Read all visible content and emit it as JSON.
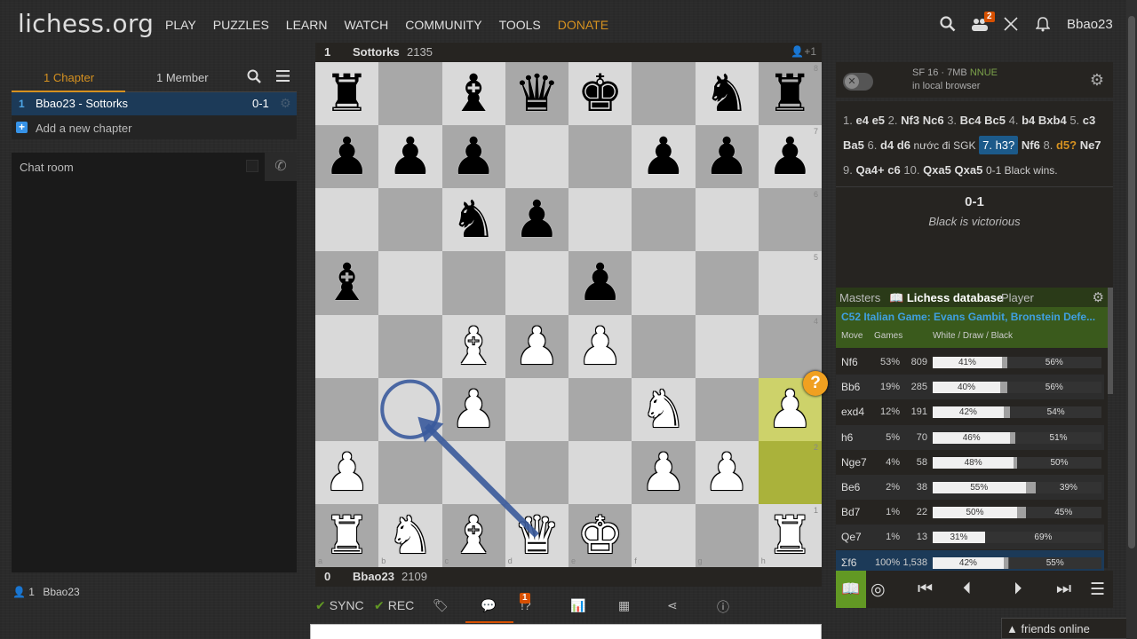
{
  "header": {
    "logo": "lichess.org",
    "nav": [
      "PLAY",
      "PUZZLES",
      "LEARN",
      "WATCH",
      "COMMUNITY",
      "TOOLS",
      "DONATE"
    ],
    "challenge_count": "2",
    "username": "Bbao23"
  },
  "study": {
    "tabs": [
      "1 Chapter",
      "1 Member"
    ],
    "chapter": {
      "num": "1",
      "name": "Bbao23 - Sottorks",
      "result": "0-1"
    },
    "add_chapter": "Add a new chapter",
    "chat_title": "Chat room",
    "members": "1",
    "member_name": "Bbao23"
  },
  "players": {
    "top": {
      "score": "1",
      "name": "Sottorks",
      "rating": "2135",
      "extra": "+1"
    },
    "bottom": {
      "score": "0",
      "name": "Bbao23",
      "rating": "2109"
    }
  },
  "board": {
    "files": [
      "a",
      "b",
      "c",
      "d",
      "e",
      "f",
      "g",
      "h"
    ],
    "ranks": [
      "8",
      "7",
      "6",
      "5",
      "4",
      "3",
      "2",
      "1"
    ],
    "pieces": [
      {
        "sq": "a8",
        "p": "r"
      },
      {
        "sq": "c8",
        "p": "b"
      },
      {
        "sq": "d8",
        "p": "q"
      },
      {
        "sq": "e8",
        "p": "k"
      },
      {
        "sq": "g8",
        "p": "n"
      },
      {
        "sq": "h8",
        "p": "r"
      },
      {
        "sq": "a7",
        "p": "p"
      },
      {
        "sq": "b7",
        "p": "p"
      },
      {
        "sq": "c7",
        "p": "p"
      },
      {
        "sq": "f7",
        "p": "p"
      },
      {
        "sq": "g7",
        "p": "p"
      },
      {
        "sq": "h7",
        "p": "p"
      },
      {
        "sq": "c6",
        "p": "n"
      },
      {
        "sq": "d6",
        "p": "p"
      },
      {
        "sq": "a5",
        "p": "b"
      },
      {
        "sq": "e5",
        "p": "p"
      },
      {
        "sq": "c4",
        "p": "B"
      },
      {
        "sq": "d4",
        "p": "P"
      },
      {
        "sq": "e4",
        "p": "P"
      },
      {
        "sq": "c3",
        "p": "P"
      },
      {
        "sq": "f3",
        "p": "N"
      },
      {
        "sq": "h3",
        "p": "P"
      },
      {
        "sq": "a2",
        "p": "P"
      },
      {
        "sq": "f2",
        "p": "P"
      },
      {
        "sq": "g2",
        "p": "P"
      },
      {
        "sq": "a1",
        "p": "R"
      },
      {
        "sq": "b1",
        "p": "N"
      },
      {
        "sq": "c1",
        "p": "B"
      },
      {
        "sq": "d1",
        "p": "Q"
      },
      {
        "sq": "e1",
        "p": "K"
      },
      {
        "sq": "h1",
        "p": "R"
      }
    ],
    "last_move": [
      "h2",
      "h3"
    ],
    "arrow": {
      "from": "d1",
      "to": "b3",
      "color": "#3a5a9c"
    }
  },
  "tools": {
    "sync": "SYNC",
    "rec": "REC",
    "notif": "1"
  },
  "engine": {
    "name": "SF 16 · 7MB",
    "nnue": "NNUE",
    "location": "in local browser"
  },
  "moves": {
    "seq": [
      {
        "t": "idx",
        "v": "1."
      },
      {
        "t": "mv",
        "v": "e4"
      },
      {
        "t": "mv",
        "v": "e5"
      },
      {
        "t": "idx",
        "v": "2."
      },
      {
        "t": "mv",
        "v": "Nf3"
      },
      {
        "t": "mv",
        "v": "Nc6"
      },
      {
        "t": "idx",
        "v": "3."
      },
      {
        "t": "mv",
        "v": "Bc4"
      },
      {
        "t": "mv",
        "v": "Bc5"
      },
      {
        "t": "idx",
        "v": "4."
      },
      {
        "t": "mv",
        "v": "b4"
      },
      {
        "t": "mv",
        "v": "Bxb4"
      },
      {
        "t": "idx",
        "v": "5."
      },
      {
        "t": "mv",
        "v": "c3"
      },
      {
        "t": "mv",
        "v": "Ba5"
      },
      {
        "t": "idx",
        "v": "6."
      },
      {
        "t": "mv",
        "v": "d4"
      },
      {
        "t": "mv",
        "v": "d6"
      },
      {
        "t": "cmt",
        "v": "nước đi SGK"
      },
      {
        "t": "cur",
        "v": "7. h3?"
      },
      {
        "t": "mv",
        "v": "Nf6"
      },
      {
        "t": "idx",
        "v": "8."
      },
      {
        "t": "inacc",
        "v": "d5?"
      },
      {
        "t": "mv",
        "v": "Ne7"
      },
      {
        "t": "idx",
        "v": "9."
      },
      {
        "t": "mv",
        "v": "Qa4+"
      },
      {
        "t": "mv",
        "v": "c6"
      },
      {
        "t": "idx",
        "v": "10."
      },
      {
        "t": "mv",
        "v": "Qxa5"
      },
      {
        "t": "mv",
        "v": "Qxa5"
      },
      {
        "t": "cmt",
        "v": "0-1 Black wins."
      }
    ],
    "result": "0-1",
    "status": "Black is victorious"
  },
  "explorer": {
    "tabs": [
      "Masters",
      "Lichess database",
      "Player"
    ],
    "opening": "C52 Italian Game: Evans Gambit, Bronstein Defe...",
    "headers": [
      "Move",
      "Games",
      "White / Draw / Black"
    ],
    "rows": [
      {
        "move": "Nf6",
        "pct": "53%",
        "games": "809",
        "w": 41,
        "d": 3,
        "b": 56
      },
      {
        "move": "Bb6",
        "pct": "19%",
        "games": "285",
        "w": 40,
        "d": 4,
        "b": 56
      },
      {
        "move": "exd4",
        "pct": "12%",
        "games": "191",
        "w": 42,
        "d": 4,
        "b": 54
      },
      {
        "move": "h6",
        "pct": "5%",
        "games": "70",
        "w": 46,
        "d": 3,
        "b": 51
      },
      {
        "move": "Nge7",
        "pct": "4%",
        "games": "58",
        "w": 48,
        "d": 2,
        "b": 50
      },
      {
        "move": "Be6",
        "pct": "2%",
        "games": "38",
        "w": 55,
        "d": 6,
        "b": 39
      },
      {
        "move": "Bd7",
        "pct": "1%",
        "games": "22",
        "w": 50,
        "d": 5,
        "b": 45
      },
      {
        "move": "Qe7",
        "pct": "1%",
        "games": "13",
        "w": 31,
        "d": 0,
        "b": 69
      },
      {
        "move": "Σf6",
        "pct": "100%",
        "games": "1,538",
        "w": 42,
        "d": 3,
        "b": 55
      }
    ]
  },
  "friends": "friends online"
}
